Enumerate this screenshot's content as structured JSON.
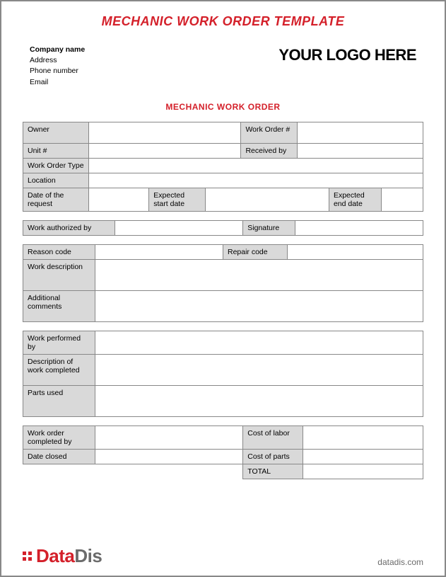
{
  "title": "MECHANIC WORK ORDER TEMPLATE",
  "company": {
    "name_label": "Company name",
    "address_label": "Address",
    "phone_label": "Phone number",
    "email_label": "Email"
  },
  "logo_text": "YOUR LOGO HERE",
  "subheader": "MECHANIC WORK ORDER",
  "sec1": {
    "owner": "Owner",
    "work_order_num": "Work Order #",
    "unit_num": "Unit #",
    "received_by": "Received by",
    "work_order_type": "Work Order Type",
    "location": "Location",
    "date_request": "Date of the request",
    "expected_start": "Expected start date",
    "expected_end": "Expected end date"
  },
  "sec2": {
    "authorized_by": "Work authorized by",
    "signature": "Signature"
  },
  "sec3": {
    "reason_code": "Reason code",
    "repair_code": "Repair code",
    "work_description": "Work description",
    "additional_comments": "Additional comments"
  },
  "sec4": {
    "work_performed_by": "Work performed by",
    "description_completed": "Description of work completed",
    "parts_used": "Parts used"
  },
  "sec5": {
    "completed_by": "Work order completed by",
    "cost_labor": "Cost of labor",
    "date_closed": "Date closed",
    "cost_parts": "Cost of parts",
    "total": "TOTAL"
  },
  "brand": {
    "part1": "Data",
    "part2": "Dis"
  },
  "site": "datadis.com"
}
